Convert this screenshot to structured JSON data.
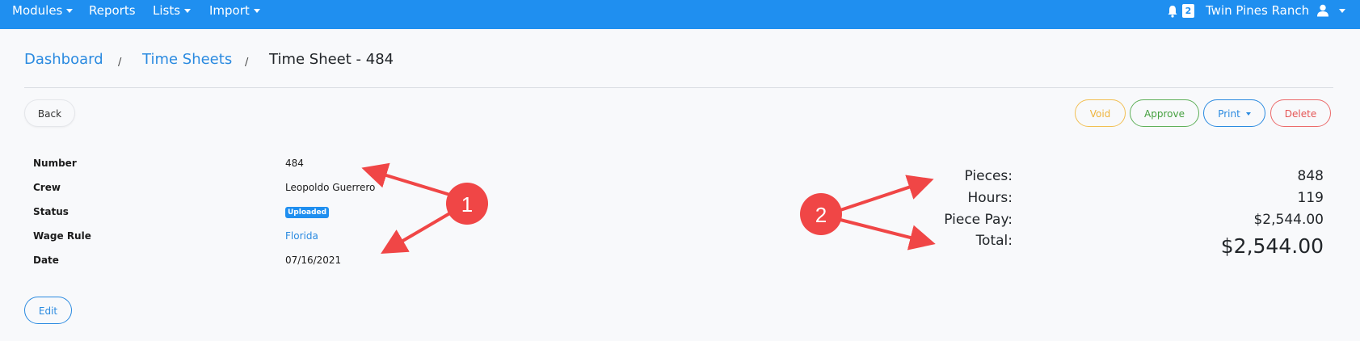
{
  "nav": {
    "modules": "Modules",
    "reports": "Reports",
    "lists": "Lists",
    "import": "Import",
    "notification_count": "2",
    "farm_name": "Twin Pines Ranch"
  },
  "breadcrumb": {
    "dashboard": "Dashboard",
    "sep1": "/",
    "time_sheets": "Time Sheets",
    "sep2": "/",
    "current": "Time Sheet - 484"
  },
  "actions": {
    "back": "Back",
    "void": "Void",
    "approve": "Approve",
    "print": "Print",
    "delete": "Delete",
    "edit": "Edit"
  },
  "details": {
    "number_label": "Number",
    "number_value": "484",
    "crew_label": "Crew",
    "crew_value": "Leopoldo Guerrero",
    "status_label": "Status",
    "status_value": "Uploaded",
    "wage_rule_label": "Wage Rule",
    "wage_rule_value": "Florida",
    "date_label": "Date",
    "date_value": "07/16/2021"
  },
  "summary": {
    "pieces_label": "Pieces:",
    "pieces_value": "848",
    "hours_label": "Hours:",
    "hours_value": "119",
    "piece_pay_label": "Piece Pay:",
    "piece_pay_value": "$2,544.00",
    "total_label": "Total:",
    "total_value": "$2,544.00"
  },
  "annotations": {
    "marker1": "1",
    "marker2": "2"
  },
  "colors": {
    "topbar": "#1f8ff0",
    "link": "#2a8ae0",
    "void": "#efb43c",
    "approve": "#45a03f",
    "delete": "#e55555",
    "annotation": "#f04646"
  }
}
